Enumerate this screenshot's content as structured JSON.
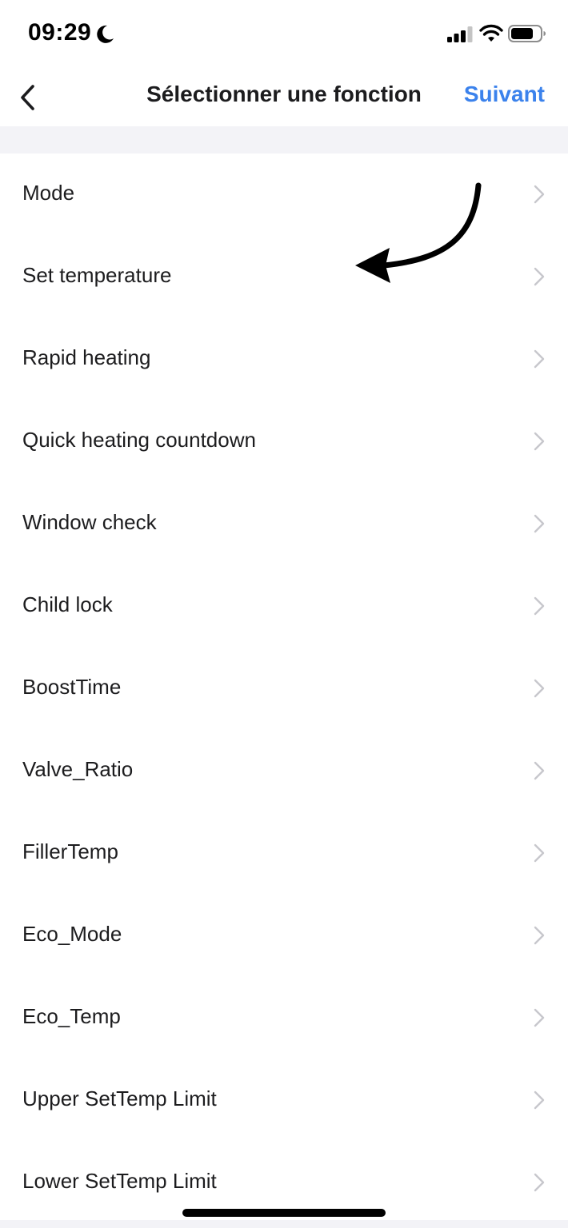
{
  "status_bar": {
    "time": "09:29",
    "icons": [
      "moon-icon",
      "signal-icon",
      "wifi-icon",
      "battery-icon"
    ]
  },
  "nav": {
    "back_icon": "chevron-left-icon",
    "title": "Sélectionner une fonction",
    "next_label": "Suivant"
  },
  "colors": {
    "accent": "#3b82ec",
    "text": "#1c1c1e",
    "chevron": "#c7c7cc",
    "band": "#f3f3f7"
  },
  "functions": [
    {
      "label": "Mode"
    },
    {
      "label": "Set temperature"
    },
    {
      "label": "Rapid heating"
    },
    {
      "label": "Quick heating countdown"
    },
    {
      "label": "Window check"
    },
    {
      "label": "Child lock"
    },
    {
      "label": "BoostTime"
    },
    {
      "label": "Valve_Ratio"
    },
    {
      "label": "FillerTemp"
    },
    {
      "label": "Eco_Mode"
    },
    {
      "label": "Eco_Temp"
    },
    {
      "label": "Upper SetTemp Limit"
    },
    {
      "label": "Lower SetTemp Limit"
    }
  ]
}
